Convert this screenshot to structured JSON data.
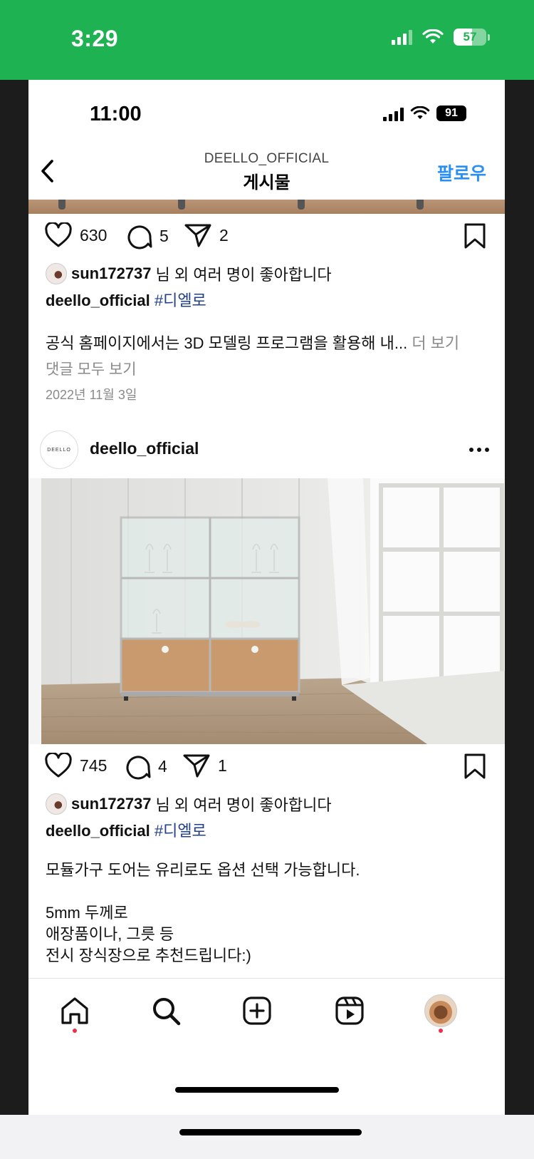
{
  "outer_status": {
    "time": "3:29",
    "battery": "57",
    "battery_level": 0.57
  },
  "inner_status": {
    "time": "11:00",
    "battery": "91"
  },
  "nav": {
    "username": "DEELLO_OFFICIAL",
    "title": "게시물",
    "follow": "팔로우"
  },
  "post1": {
    "likes": "630",
    "comments": "5",
    "shares": "2",
    "liked_by_user": "sun172737",
    "liked_by_suffix": "님 외 여러 명이 좋아합니다",
    "caption_user": "deello_official",
    "caption_tag": "#디엘로",
    "caption_text": "공식 홈페이지에서는 3D 모델링 프로그램을 활용해 내...",
    "more": "더 보기",
    "view_comments": "댓글 모두 보기",
    "date": "2022년 11월 3일"
  },
  "post2": {
    "username": "deello_official",
    "avatar_text": "DEELLO",
    "likes": "745",
    "comments": "4",
    "shares": "1",
    "liked_by_user": "sun172737",
    "liked_by_suffix": "님 외 여러 명이 좋아합니다",
    "caption_user": "deello_official",
    "caption_tag": "#디엘로",
    "caption_lines": [
      "모듈가구 도어는 유리로도 옵션 선택 가능합니다.",
      "",
      "5mm 두께로",
      "애장품이나, 그릇 등",
      "전시 장식장으로 추천드립니다:)"
    ]
  },
  "tabs": [
    "home-icon",
    "search-icon",
    "create-icon",
    "reels-icon",
    "profile-icon"
  ],
  "colors": {
    "outer_status_bg": "#1fb253",
    "link_blue": "#2a8ff2",
    "hashtag": "#22418a",
    "notification_dot": "#ef2d50"
  }
}
